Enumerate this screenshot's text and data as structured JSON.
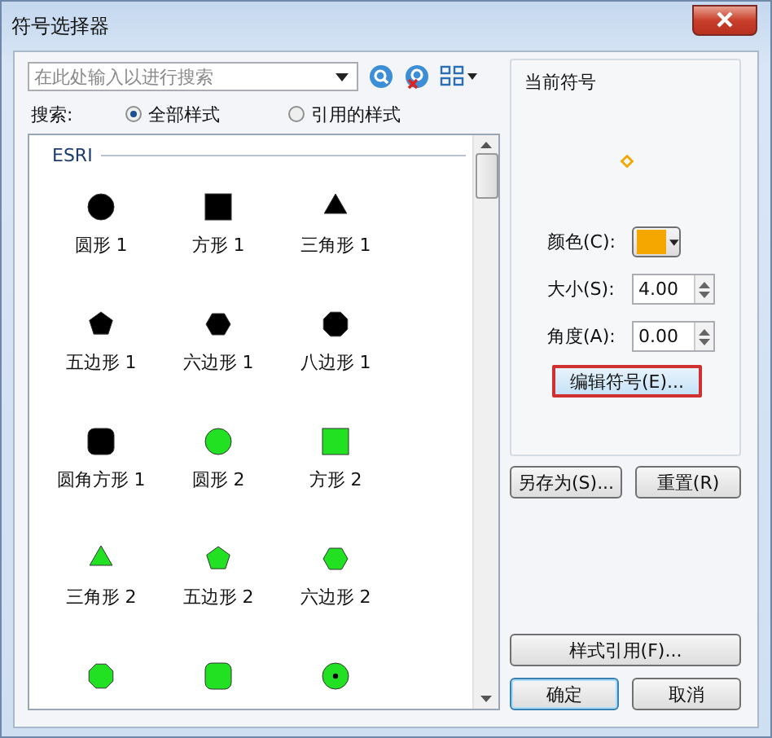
{
  "window": {
    "title": "符号选择器"
  },
  "search": {
    "placeholder": "在此处输入以进行搜索"
  },
  "scope": {
    "label": "搜索:",
    "options": [
      {
        "label": "全部样式",
        "selected": true
      },
      {
        "label": "引用的样式",
        "selected": false
      }
    ]
  },
  "gallery": {
    "group": "ESRI",
    "items": [
      {
        "name": "圆形 1",
        "kind": "circle",
        "color": "#000000"
      },
      {
        "name": "方形 1",
        "kind": "square",
        "color": "#000000"
      },
      {
        "name": "三角形 1",
        "kind": "triangle",
        "color": "#000000"
      },
      {
        "name": "五边形 1",
        "kind": "pentagon",
        "color": "#000000"
      },
      {
        "name": "六边形 1",
        "kind": "hexagon",
        "color": "#000000"
      },
      {
        "name": "八边形 1",
        "kind": "octagon",
        "color": "#000000"
      },
      {
        "name": "圆角方形 1",
        "kind": "rounded-square",
        "color": "#000000"
      },
      {
        "name": "圆形 2",
        "kind": "circle",
        "color": "#22e022"
      },
      {
        "name": "方形 2",
        "kind": "square",
        "color": "#22e022"
      },
      {
        "name": "三角形 2",
        "kind": "triangle",
        "color": "#22e022"
      },
      {
        "name": "五边形 2",
        "kind": "pentagon",
        "color": "#22e022"
      },
      {
        "name": "六边形 2",
        "kind": "hexagon",
        "color": "#22e022"
      },
      {
        "kind": "octagon",
        "color": "#22e022"
      },
      {
        "kind": "rounded-square",
        "color": "#22e022"
      },
      {
        "kind": "circle-dot",
        "color": "#22e022"
      }
    ]
  },
  "current_symbol": {
    "title": "当前符号",
    "color_label": "颜色(C):",
    "color": "#f5a700",
    "size_label": "大小(S):",
    "size": "4.00",
    "angle_label": "角度(A):",
    "angle": "0.00"
  },
  "buttons": [
    {
      "label": "编辑符号(E)...",
      "kind": "edit",
      "highlighted": true,
      "default": false
    },
    {
      "label": "另存为(S)...",
      "kind": "save",
      "highlighted": false,
      "default": false
    },
    {
      "label": "重置(R)",
      "kind": "reset",
      "highlighted": false,
      "default": false
    },
    {
      "label": "样式引用(F)...",
      "kind": "styles",
      "highlighted": false,
      "default": false
    },
    {
      "label": "确定",
      "kind": "ok",
      "highlighted": false,
      "default": true
    },
    {
      "label": "取消",
      "kind": "cancel",
      "highlighted": false,
      "default": false
    }
  ]
}
